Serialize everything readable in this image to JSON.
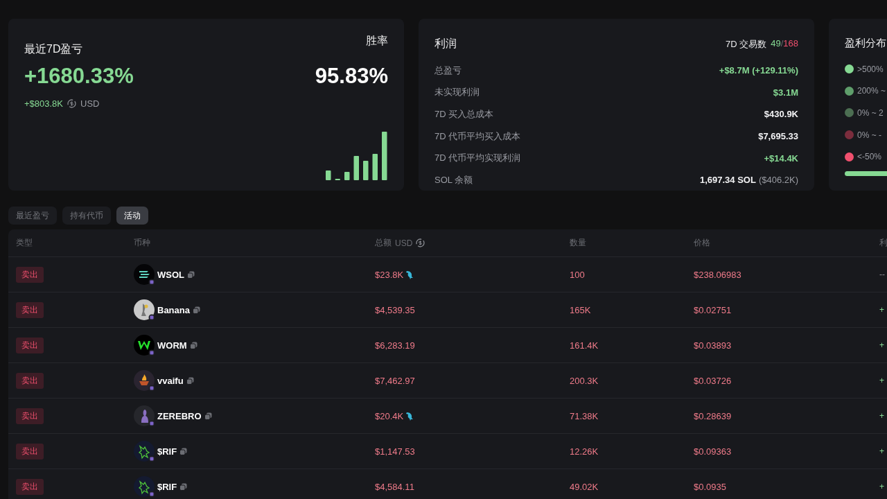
{
  "pnl_card": {
    "title": "最近7D盈亏",
    "percent": "+1680.33%",
    "amount": "+$803.8K",
    "currency": "USD",
    "winrate_label": "胜率",
    "winrate": "95.83%"
  },
  "profit_card": {
    "title": "利润",
    "trades_label": "7D 交易数",
    "trades_win": "49",
    "trades_sep": "/",
    "trades_loss": "168",
    "rows": [
      {
        "label": "总盈亏",
        "value": "+$8.7M (+129.11%)",
        "positive": true
      },
      {
        "label": "未实现利润",
        "value": "$3.1M",
        "positive": true
      },
      {
        "label": "7D 买入总成本",
        "value": "$430.9K",
        "positive": false
      },
      {
        "label": "7D 代币平均买入成本",
        "value": "$7,695.33",
        "positive": false
      },
      {
        "label": "7D 代币平均实现利润",
        "value": "+$14.4K",
        "positive": true
      },
      {
        "label": "SOL 余额",
        "value": "1,697.34 SOL",
        "note": "($406.2K)",
        "positive": false
      }
    ]
  },
  "distribution_card": {
    "title": "盈利分布",
    "items": [
      {
        "label": ">500%",
        "color": "#86d993"
      },
      {
        "label": "200% ~",
        "color": "#5f9e6b"
      },
      {
        "label": "0% ~ 2",
        "color": "#4c6e52"
      },
      {
        "label": "0% ~ -",
        "color": "#7b2d3d"
      },
      {
        "label": "<-50%",
        "color": "#f0506e"
      }
    ]
  },
  "tabs": [
    {
      "label": "最近盈亏",
      "selected": false
    },
    {
      "label": "持有代币",
      "selected": false
    },
    {
      "label": "活动",
      "selected": true
    }
  ],
  "table": {
    "columns": [
      "类型",
      "币种",
      "总额",
      "数量",
      "价格",
      "利"
    ],
    "total_unit": "USD",
    "rows": [
      {
        "type": "卖出",
        "token": "WSOL",
        "total": "$23.8K",
        "large": true,
        "amount": "100",
        "price": "$238.06983",
        "profit": "--",
        "profit_positive": false
      },
      {
        "type": "卖出",
        "token": "Banana",
        "total": "$4,539.35",
        "large": false,
        "amount": "165K",
        "price": "$0.02751",
        "profit": "+",
        "profit_positive": true
      },
      {
        "type": "卖出",
        "token": "WORM",
        "total": "$6,283.19",
        "large": false,
        "amount": "161.4K",
        "price": "$0.03893",
        "profit": "+",
        "profit_positive": true
      },
      {
        "type": "卖出",
        "token": "vvaifu",
        "total": "$7,462.97",
        "large": false,
        "amount": "200.3K",
        "price": "$0.03726",
        "profit": "+",
        "profit_positive": true
      },
      {
        "type": "卖出",
        "token": "ZEREBRO",
        "total": "$20.4K",
        "large": true,
        "amount": "71.38K",
        "price": "$0.28639",
        "profit": "+",
        "profit_positive": true
      },
      {
        "type": "卖出",
        "token": "$RIF",
        "total": "$1,147.53",
        "large": false,
        "amount": "12.26K",
        "price": "$0.09363",
        "profit": "+",
        "profit_positive": true
      },
      {
        "type": "卖出",
        "token": "$RIF",
        "total": "$4,584.11",
        "large": false,
        "amount": "49.02K",
        "price": "$0.0935",
        "profit": "+",
        "profit_positive": true
      }
    ]
  }
}
